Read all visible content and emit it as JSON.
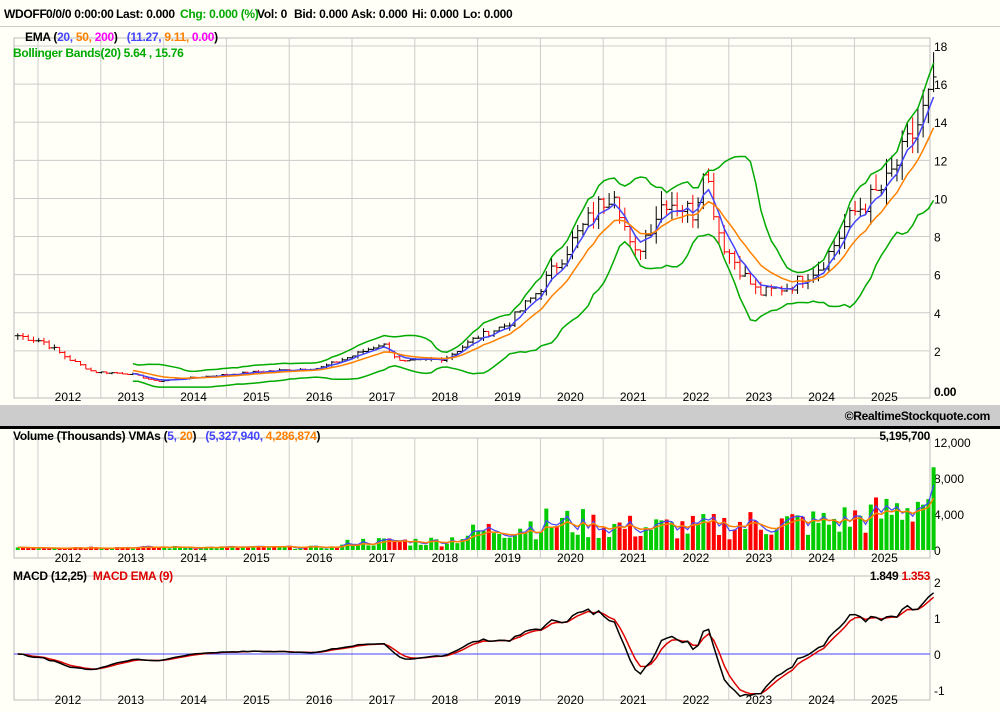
{
  "header": {
    "symbol": "WDOFF",
    "datetime": "0/0/0 0:00:00",
    "last": "Last: 0.000",
    "chg": "Chg: 0.000 (%)",
    "vol": "Vol: 0",
    "bid": "Bid: 0.000",
    "ask": "Ask: 0.000",
    "hi": "Hi: 0.000",
    "lo": "Lo: 0.000"
  },
  "price_panel": {
    "ema_label": "EMA (",
    "ema_p1": "20,",
    "ema_p2": "50,",
    "ema_p3": "200",
    "ema_close": ")",
    "ema_v1": "(11.27,",
    "ema_v2": "9.11,",
    "ema_v3": "0.00",
    "ema_vclose": ")",
    "bb_label": "Bollinger Bands(20) 5.64 , 15.76",
    "last_value": "0.00"
  },
  "copyright": "©RealtimeStockquote.com",
  "volume_panel": {
    "label": "Volume (Thousands)  VMAs (",
    "p1": "5,",
    "p2": "20",
    "pclose": ")",
    "v1": "(5,327,940,",
    "v2": "4,286,874",
    "vclose": ")",
    "last": "5,195,700"
  },
  "macd_panel": {
    "label": "MACD (12,25)",
    "ema_label": "MACD EMA (9)",
    "macd_value": "1.849",
    "signal_value": "1.353"
  },
  "colors": {
    "ema20": "#4444ff",
    "ema50": "#ff8000",
    "ema200": "#ff00ff",
    "bb": "#00aa00",
    "up": "#000000",
    "down": "#ff0000",
    "vup": "#00cc00",
    "macd": "#000000",
    "signal": "#dd0000"
  },
  "chart_data": [
    {
      "type": "ohlc",
      "title": "WDOFF",
      "x_ticks": [
        "2012",
        "2013",
        "2014",
        "2015",
        "2016",
        "2017",
        "2018",
        "2019",
        "2020",
        "2021",
        "2022",
        "2023",
        "2024",
        "2025"
      ],
      "y_ticks": [
        2,
        4,
        6,
        8,
        10,
        12,
        14,
        16,
        18
      ],
      "ylim": [
        0,
        18
      ],
      "price_keypoints": [
        [
          2011.2,
          2.8
        ],
        [
          2011.6,
          2.5
        ],
        [
          2012.0,
          1.6
        ],
        [
          2012.4,
          0.9
        ],
        [
          2013.0,
          0.8
        ],
        [
          2013.4,
          0.4
        ],
        [
          2014.0,
          0.6
        ],
        [
          2015.0,
          0.9
        ],
        [
          2016.0,
          1.1
        ],
        [
          2016.5,
          1.7
        ],
        [
          2017.0,
          2.4
        ],
        [
          2017.3,
          1.4
        ],
        [
          2018.0,
          1.6
        ],
        [
          2018.5,
          2.7
        ],
        [
          2019.0,
          3.4
        ],
        [
          2019.5,
          5.2
        ],
        [
          2020.0,
          7.6
        ],
        [
          2020.5,
          9.8
        ],
        [
          2020.7,
          10.6
        ],
        [
          2021.0,
          6.8
        ],
        [
          2021.5,
          10.0
        ],
        [
          2022.0,
          9.2
        ],
        [
          2022.1,
          12.2
        ],
        [
          2022.4,
          7.8
        ],
        [
          2022.8,
          5.8
        ],
        [
          2023.0,
          5.0
        ],
        [
          2023.5,
          5.4
        ],
        [
          2024.0,
          6.5
        ],
        [
          2024.5,
          9.2
        ],
        [
          2025.0,
          10.6
        ],
        [
          2025.5,
          13.6
        ],
        [
          2025.75,
          15.6
        ]
      ]
    },
    {
      "type": "bar",
      "title": "Volume (Thousands)",
      "y_ticks": [
        0,
        4000,
        8000,
        12000
      ],
      "y_tick_labels": [
        "0",
        "4,000",
        "8,000",
        "12,000"
      ],
      "ylim": [
        0,
        12000
      ],
      "volume_keypoints": [
        [
          2011.2,
          300
        ],
        [
          2016.3,
          300
        ],
        [
          2016.5,
          900
        ],
        [
          2018.0,
          1000
        ],
        [
          2018.5,
          2000
        ],
        [
          2019.5,
          3000
        ],
        [
          2020.0,
          3000
        ],
        [
          2021.0,
          2500
        ],
        [
          2022.0,
          2500
        ],
        [
          2023.0,
          3000
        ],
        [
          2024.0,
          3000
        ],
        [
          2025.0,
          4000
        ],
        [
          2025.75,
          6000
        ]
      ]
    },
    {
      "type": "line",
      "title": "MACD (12,25)",
      "series": [
        "MACD",
        "MACD EMA (9)"
      ],
      "y_ticks": [
        -1,
        0,
        1,
        2
      ],
      "ylim": [
        -1,
        2
      ]
    }
  ]
}
